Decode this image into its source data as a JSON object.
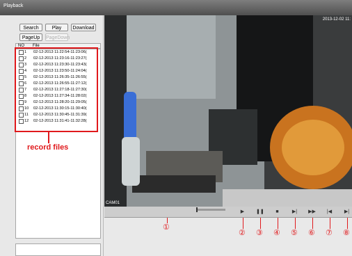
{
  "window": {
    "title": "Playback"
  },
  "toolbar": {
    "search": "Search",
    "play": "Play",
    "download": "Download",
    "pageup": "PageUp",
    "pagedown": "PageDown"
  },
  "list": {
    "col_no": "NO",
    "col_file": "File",
    "rows": [
      {
        "no": "1",
        "file": "02-12-2013 11:22:54-11:23:06("
      },
      {
        "no": "2",
        "file": "02-12-2013 11:23:16-11:23:27("
      },
      {
        "no": "3",
        "file": "02-12-2013 11:23:30-11:23:43("
      },
      {
        "no": "4",
        "file": "02-12-2013 11:23:50-11:24:04("
      },
      {
        "no": "5",
        "file": "02-12-2013 11:26:35-11:26:55("
      },
      {
        "no": "6",
        "file": "02-12-2013 11:26:55-11:27:12("
      },
      {
        "no": "7",
        "file": "02-12-2013 11:27:18-11:27:30("
      },
      {
        "no": "8",
        "file": "02-12-2013 11:27:34-11:28:02("
      },
      {
        "no": "9",
        "file": "02-12-2013 11:28:20-11:29:05("
      },
      {
        "no": "10",
        "file": "02-12-2013 11:30:15-11:30:40("
      },
      {
        "no": "11",
        "file": "02-12-2013 11:30:45-11:31:39("
      },
      {
        "no": "12",
        "file": "02-12-2013 11:31:41-11:32:28("
      }
    ]
  },
  "annotation": {
    "record_files": "record files"
  },
  "video": {
    "timestamp": "2013-12-02 11:",
    "camera": "CAM01"
  },
  "controls": {
    "play_icon": "play-icon",
    "pause_icon": "pause-icon",
    "stop_icon": "stop-icon",
    "step_icon": "step-forward-icon",
    "fast_icon": "fast-forward-icon",
    "prev_icon": "previous-icon",
    "next_icon": "next-icon"
  },
  "callouts": [
    "①",
    "②",
    "③",
    "④",
    "⑤",
    "⑥",
    "⑦",
    "⑧"
  ],
  "colors": {
    "annotation_red": "#e0191c",
    "titlebar": "#5e5e5e"
  }
}
